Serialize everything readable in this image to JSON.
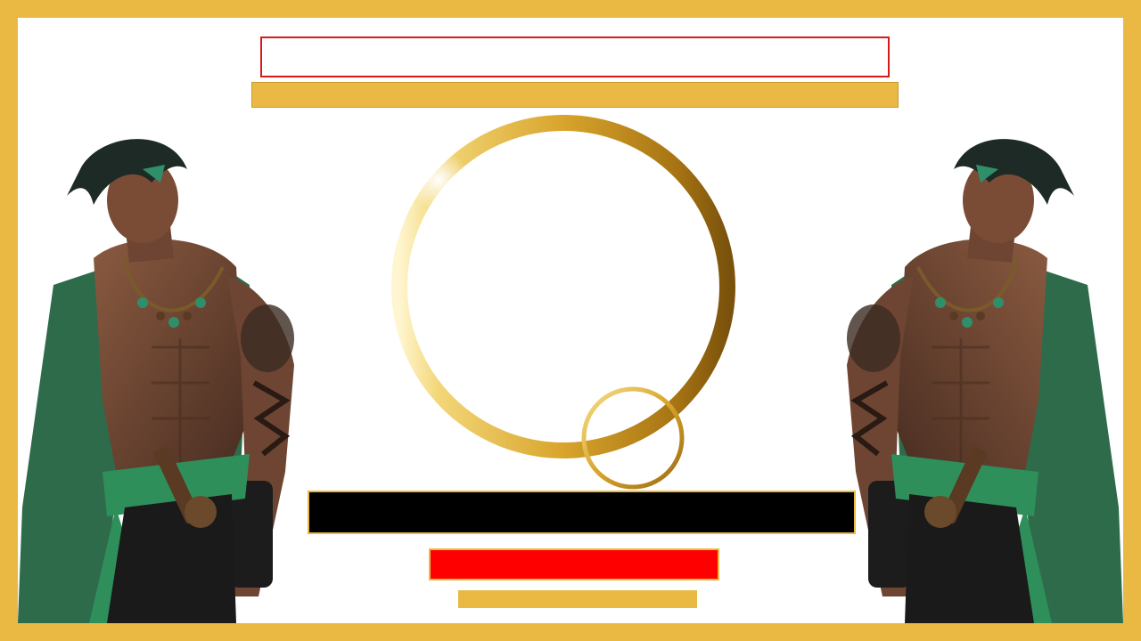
{
  "slide": {
    "title": "",
    "subtitle": "",
    "main_banner": "",
    "red_label": "",
    "footer_label": ""
  },
  "illustration": {
    "subject": "swordsman-character-icon",
    "count": 2
  },
  "colors": {
    "frame": "#E9B943",
    "title_border": "#D91A1A",
    "banner": "#000000",
    "red_label": "#FF0000",
    "ring_gold": "#D4A33A"
  }
}
